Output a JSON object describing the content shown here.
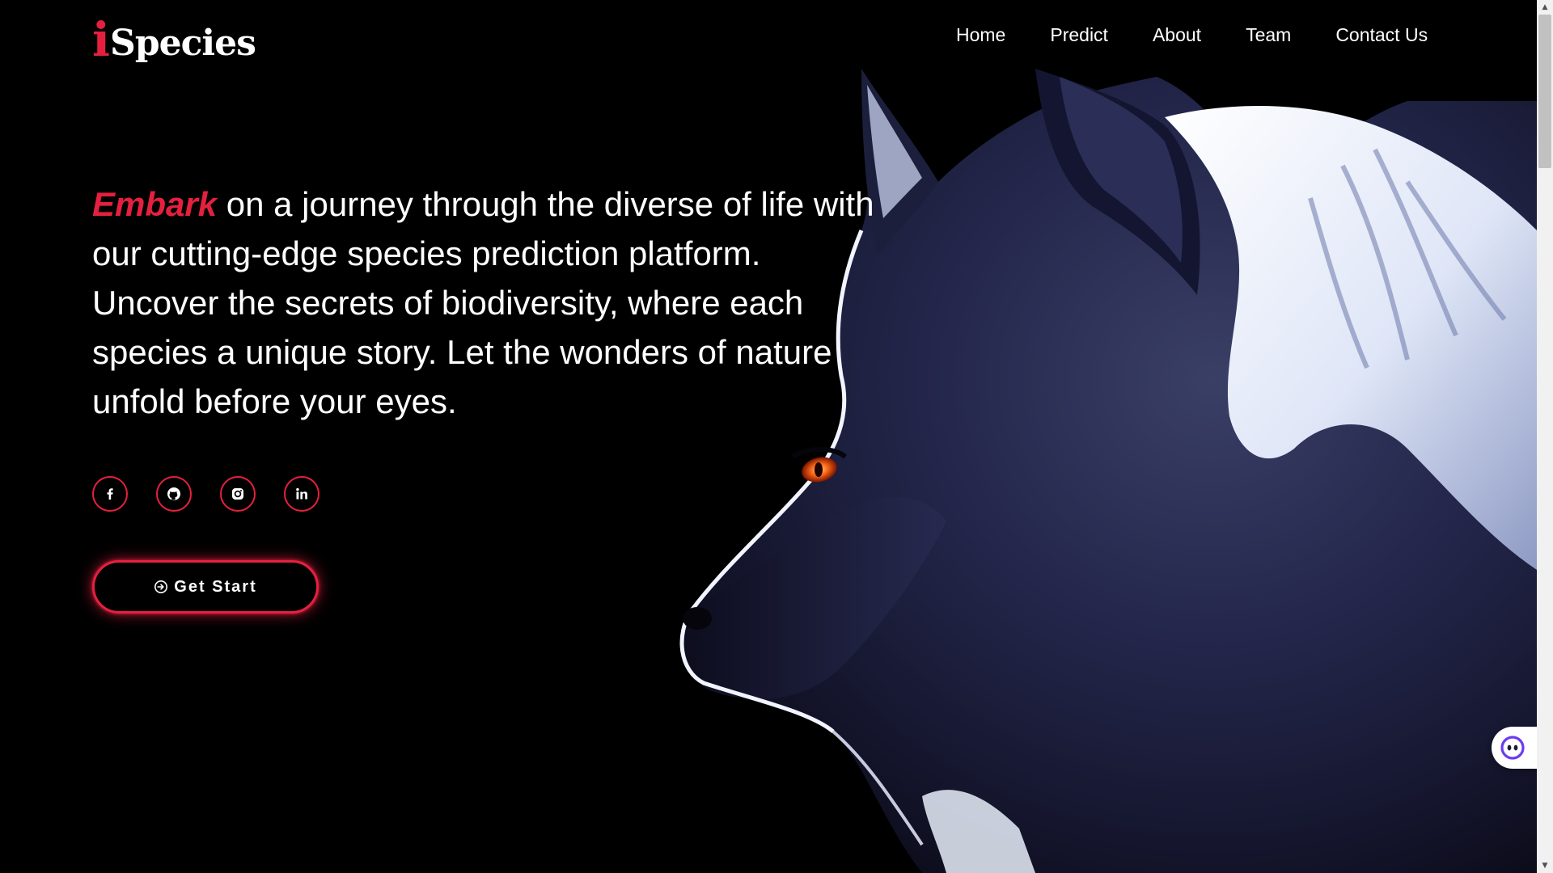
{
  "brand": {
    "logo_i": "i",
    "logo_rest": "Species",
    "accent_color": "#e5203f"
  },
  "nav": {
    "items": [
      {
        "label": "Home"
      },
      {
        "label": "Predict"
      },
      {
        "label": "About"
      },
      {
        "label": "Team"
      },
      {
        "label": "Contact Us"
      }
    ]
  },
  "hero": {
    "accent_word": "Embark",
    "body": " on a journey through the diverse of life with our cutting-edge species prediction platform. Uncover the secrets of biodiversity, where each species a unique story. Let the wonders of nature unfold before your eyes.",
    "image": "wolf-illustration"
  },
  "social": [
    {
      "icon": "facebook-icon"
    },
    {
      "icon": "github-icon"
    },
    {
      "icon": "instagram-icon"
    },
    {
      "icon": "linkedin-icon"
    }
  ],
  "cta": {
    "label": "Get Start",
    "icon": "arrow-circle-right-icon"
  },
  "assistant": {
    "icon": "chat-assistant-icon"
  },
  "scrollbar": {
    "up": "▲",
    "down": "▼"
  }
}
